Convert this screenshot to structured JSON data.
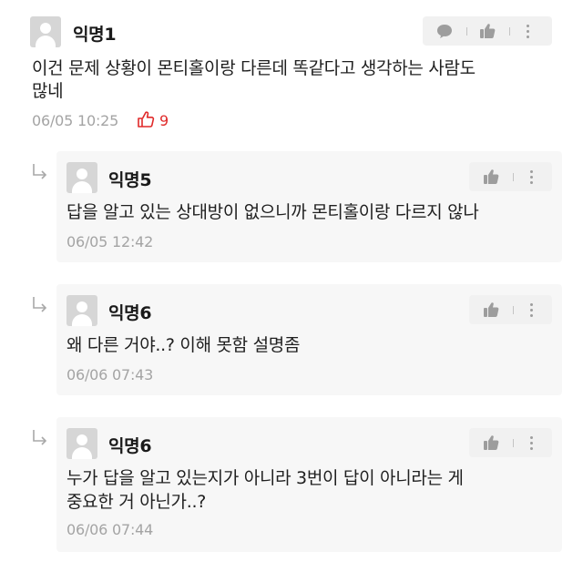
{
  "comment": {
    "author": "익명1",
    "text_line1": "이건 문제 상황이 몬티홀이랑 다른데 똑같다고 생각하는 사람도",
    "text_line2": "많네",
    "time": "06/05 10:25",
    "like_count": "9"
  },
  "replies": [
    {
      "author": "익명5",
      "text_line1": "답을 알고 있는 상대방이 없으니까 몬티홀이랑 다르지 않나",
      "time": "06/05 12:42"
    },
    {
      "author": "익명6",
      "text_line1": "왜 다른 거야..? 이해 못함 설명좀",
      "time": "06/06 07:43"
    },
    {
      "author": "익명6",
      "text_line1": "누가 답을 알고 있는지가 아니라 3번이 답이 아니라는 게",
      "text_line2": "중요한 거 아닌가..?",
      "time": "06/06 07:44"
    }
  ],
  "icons": {
    "comment_action": "speech-bubble-icon",
    "like_action": "thumbs-up-icon",
    "more_action": "vertical-dots-icon",
    "reply_marker": "reply-arrow-icon",
    "liked_indicator": "thumbs-up-outline-icon"
  },
  "colors": {
    "accent_red": "#e02a2a",
    "timestamp_gray": "#a4a4a4",
    "reply_card_bg": "#f7f7f7",
    "action_bg": "#f1f1f1"
  }
}
